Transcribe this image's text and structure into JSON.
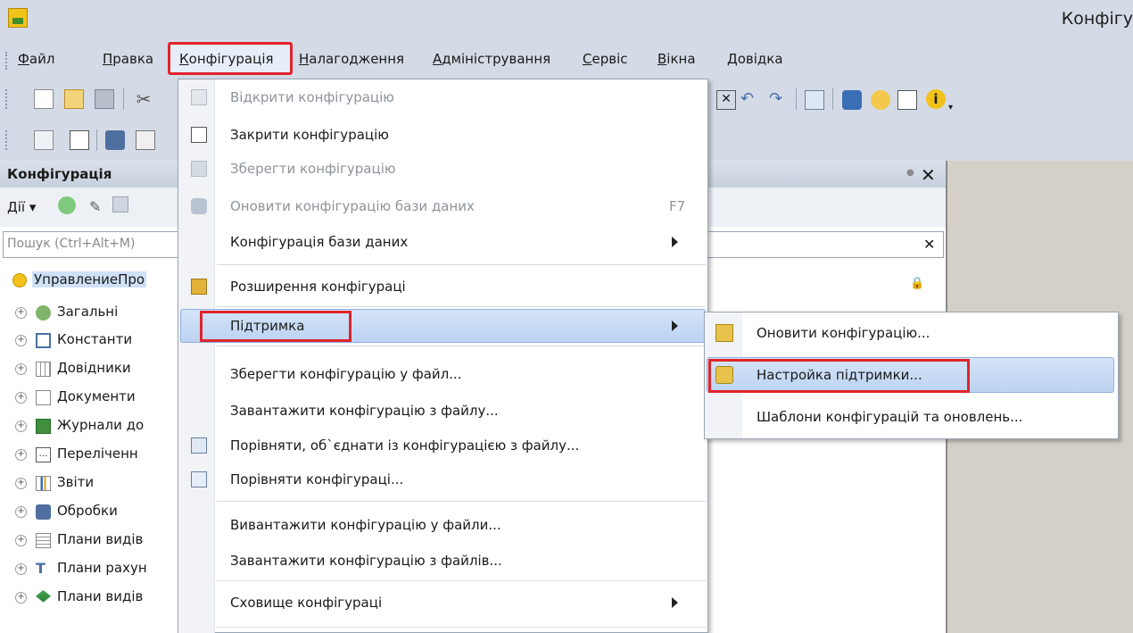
{
  "window": {
    "title": "Конфігу"
  },
  "menubar": {
    "items": [
      {
        "label": "Файл"
      },
      {
        "label": "Правка"
      },
      {
        "label": "Конфігурація"
      },
      {
        "label": "Налагодження"
      },
      {
        "label": "Адміністрування"
      },
      {
        "label": "Сервіс"
      },
      {
        "label": "Вікна"
      },
      {
        "label": "Довідка"
      }
    ]
  },
  "panel": {
    "title": "Конфігурація",
    "actions_label": "Дії ▾",
    "search_placeholder": "Пошук (Ctrl+Alt+M)",
    "root": "УправлениеПро",
    "tree": [
      {
        "label": "Загальні"
      },
      {
        "label": "Константи"
      },
      {
        "label": "Довідники"
      },
      {
        "label": "Документи"
      },
      {
        "label": "Журнали до"
      },
      {
        "label": "Переліченн"
      },
      {
        "label": "Звіти"
      },
      {
        "label": "Обробки"
      },
      {
        "label": "Плани видів"
      },
      {
        "label": "Плани рахун"
      },
      {
        "label": "Плани видів"
      }
    ]
  },
  "main_menu": {
    "items": [
      {
        "label": "Відкрити конфігурацію",
        "disabled": true
      },
      {
        "label": "Закрити конфігурацію"
      },
      {
        "label": "Зберегти конфігурацію",
        "disabled": true
      },
      {
        "label": "Оновити конфігурацію бази даних",
        "disabled": true,
        "shortcut": "F7"
      },
      {
        "label": "Конфігурація бази даних",
        "submenu": true
      },
      {
        "label": "Розширення конфігураці"
      },
      {
        "label": "Підтримка",
        "submenu": true,
        "highlighted": true
      },
      {
        "label": "Зберегти конфігурацію у файл..."
      },
      {
        "label": "Завантажити конфігурацію з файлу..."
      },
      {
        "label": "Порівняти, об`єднати із конфігурацією з файлу..."
      },
      {
        "label": "Порівняти конфігураці..."
      },
      {
        "label": "Вивантажити конфігурацію у файли..."
      },
      {
        "label": "Завантажити конфігурацію з файлів..."
      },
      {
        "label": "Сховище конфігураці",
        "submenu": true
      }
    ]
  },
  "sub_menu": {
    "items": [
      {
        "label": "Оновити конфігурацію..."
      },
      {
        "label": "Настройка підтримки...",
        "highlighted": true
      },
      {
        "label": "Шаблони конфігурацій та оновлень..."
      }
    ]
  },
  "colors": {
    "highlight_border": "#e0242b",
    "selection": "#bcd3f2",
    "chrome": "#d4dbe6"
  }
}
